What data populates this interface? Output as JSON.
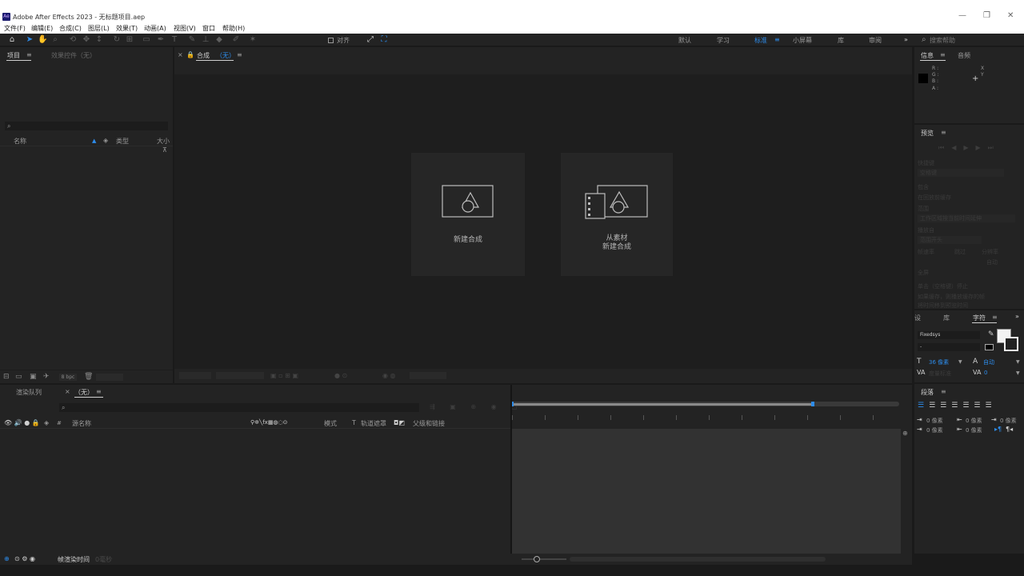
{
  "window": {
    "app_badge": "Ae",
    "title": "Adobe After Effects 2023 - 无标题项目.aep",
    "minimize": "—",
    "maximize": "❐",
    "close": "✕"
  },
  "menu": [
    "文件(F)",
    "编辑(E)",
    "合成(C)",
    "图层(L)",
    "效果(T)",
    "动画(A)",
    "视图(V)",
    "窗口",
    "帮助(H)"
  ],
  "toolbar": {
    "snap_label": "对齐",
    "workspaces": [
      "默认",
      "学习",
      "标准",
      "小屏幕",
      "库",
      "审阅"
    ],
    "active_workspace": "标准",
    "more": "»",
    "search_placeholder": "搜索帮助"
  },
  "project_panel": {
    "tab_project": "项目",
    "tab_effects": "效果控件（无）",
    "search_icon": "⌕",
    "col_name": "名称",
    "col_type": "类型",
    "col_size": "大小",
    "bpc": "8 bpc"
  },
  "comp_panel": {
    "tab_label": "合成",
    "tab_value": "（无）",
    "new_comp": "新建合成",
    "from_footage_line1": "从素材",
    "from_footage_line2": "新建合成"
  },
  "info_panel": {
    "tab_info": "信息",
    "tab_audio": "音频",
    "rgba": [
      "R :",
      "G :",
      "B :",
      "A :"
    ],
    "xy": [
      "X",
      "Y"
    ],
    "plus": "+"
  },
  "preview_panel": {
    "tab": "预览",
    "controls": [
      "⏮",
      "◀",
      "▶",
      "▶",
      "⏭"
    ],
    "rows": [
      "快捷键",
      "空格键",
      "包含",
      "在回放前缓存",
      "范围",
      "工作区域按当前时间延伸",
      "播放自",
      "范围开头",
      "帧速率",
      "跳过",
      "分辨率",
      "自动",
      "全屏",
      "单击（空格键）停止",
      "如果缓存，则播放缓存的帧",
      "将时间移到预览时间"
    ]
  },
  "character_panel": {
    "tab_lib_short": "设",
    "tab_lib": "库",
    "tab_char": "字符",
    "font": "Fixedsys",
    "style": "-",
    "size": "36 像素",
    "leading": "自动",
    "tracking": "度量标准",
    "tsume": "0"
  },
  "paragraph_panel": {
    "tab": "段落",
    "indent_values": [
      "0 像素",
      "0 像素",
      "0 像素",
      "0 像素",
      "0 像素"
    ]
  },
  "timeline": {
    "tab_render": "渲染队列",
    "tab_comp": "（无）",
    "close_x": "×",
    "col_source": "源名称",
    "col_mode": "模式",
    "col_t": "T",
    "col_track": "轨道遮罩",
    "col_parent": "父级和链接",
    "bottom_label": "帧渲染时间",
    "bottom_value": "0毫秒"
  },
  "colors": {
    "accent": "#2d8ceb",
    "panel": "#232323",
    "bg": "#1a1a1a",
    "title_bg": "#ffffff"
  }
}
